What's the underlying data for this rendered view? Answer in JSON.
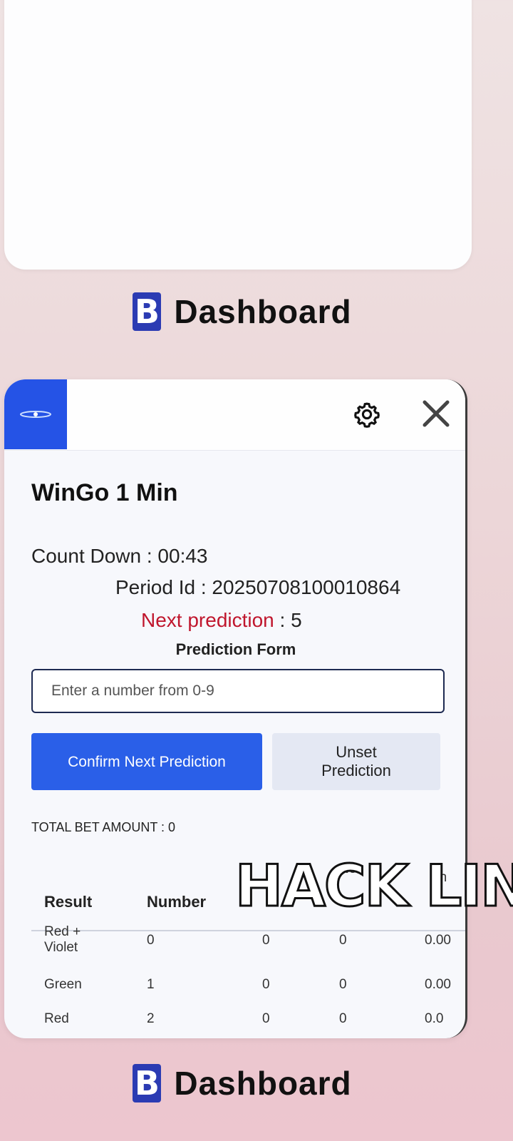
{
  "app_label": {
    "icon_letter": "B",
    "name": "Dashboard"
  },
  "panel": {
    "title": "WinGo 1 Min",
    "countdown": "Count Down : 00:43",
    "period_id": "Period Id : 20250708100010864",
    "next_prediction_label": "Next prediction",
    "next_prediction_value": " : 5",
    "form_title": "Prediction Form",
    "input_placeholder": "Enter a number from 0-9",
    "confirm_button": "Confirm Next Prediction",
    "unset_button": "Unset Prediction",
    "total_bet": "TOTAL BET AMOUNT : 0",
    "icons": [
      "drag-handle-icon",
      "gear-icon",
      "close-icon"
    ]
  },
  "table": {
    "headers": [
      "Result",
      "Number",
      "No",
      "An"
    ],
    "rows": [
      [
        "Red + Violet",
        "0",
        "0",
        "0",
        "0.00"
      ],
      [
        "Green",
        "1",
        "0",
        "0",
        "0.00"
      ],
      [
        "Red",
        "2",
        "0",
        "0",
        "0.0"
      ]
    ]
  },
  "overlay": {
    "text": "HACK LIN"
  },
  "colors": {
    "accent": "#2a5fe8",
    "next_label": "#c0162d",
    "brand": "#2b3bb3"
  }
}
